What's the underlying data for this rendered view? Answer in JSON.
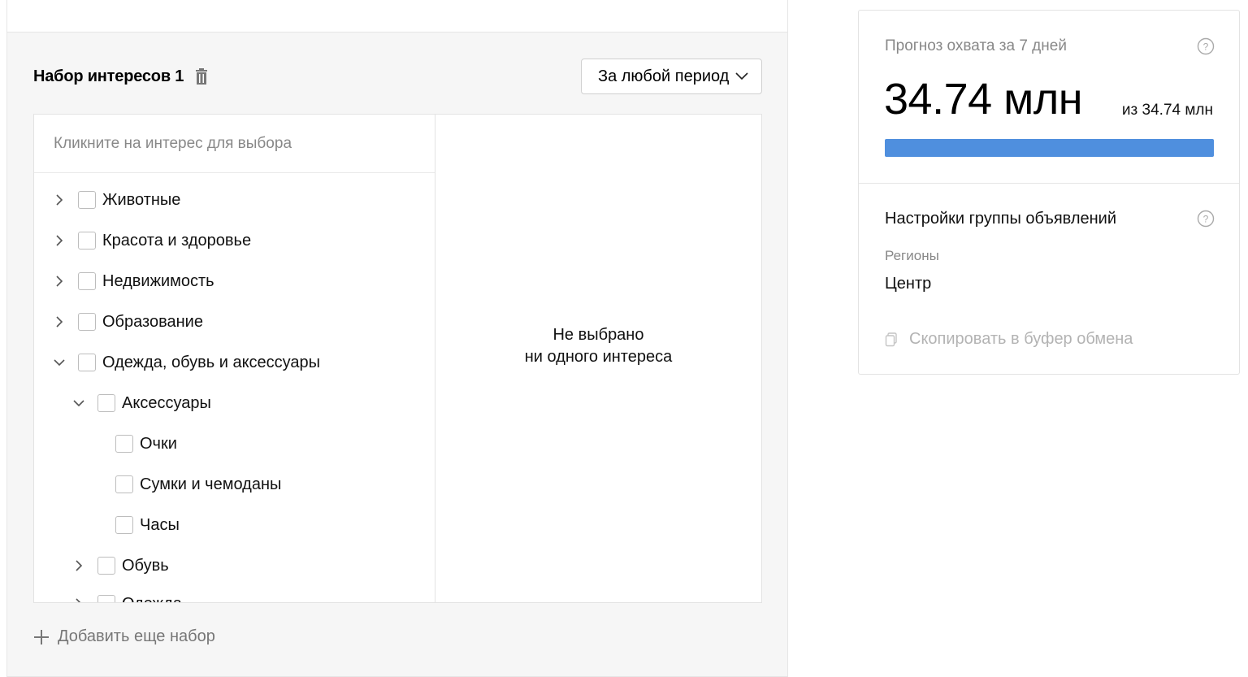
{
  "interest_set": {
    "title": "Набор интересов 1",
    "period_label": "За любой период",
    "hint": "Кликните на интерес для выбора",
    "tree": [
      {
        "label": "Животные",
        "expanded": false,
        "checked": false
      },
      {
        "label": "Красота и здоровье",
        "expanded": false,
        "checked": false
      },
      {
        "label": "Недвижимость",
        "expanded": false,
        "checked": false
      },
      {
        "label": "Образование",
        "expanded": false,
        "checked": false
      },
      {
        "label": "Одежда, обувь и аксессуары",
        "expanded": true,
        "checked": false
      },
      {
        "label": "Аксессуары",
        "expanded": true,
        "checked": false
      },
      {
        "label": "Очки",
        "checked": false
      },
      {
        "label": "Сумки и чемоданы",
        "checked": false
      },
      {
        "label": "Часы",
        "checked": false
      },
      {
        "label": "Обувь",
        "expanded": false,
        "checked": false
      },
      {
        "label": "Одежда",
        "expanded": false,
        "checked": false
      }
    ],
    "empty_line1": "Не выбрано",
    "empty_line2": "ни одного интереса",
    "add_set_label": "Добавить еще набор"
  },
  "forecast": {
    "title": "Прогноз охвата за 7 дней",
    "value": "34.74 млн",
    "total": "из 34.74 млн",
    "progress_fraction": 1.0,
    "bar_color": "#4f8fde"
  },
  "ad_group_settings": {
    "title": "Настройки группы объявлений",
    "regions_label": "Регионы",
    "region_value": "Центр",
    "copy_label": "Скопировать в буфер обмена"
  },
  "icons": [
    "trash-icon",
    "chevron-down-icon",
    "chevron-right-icon",
    "help-icon",
    "plus-icon",
    "copy-icon"
  ]
}
